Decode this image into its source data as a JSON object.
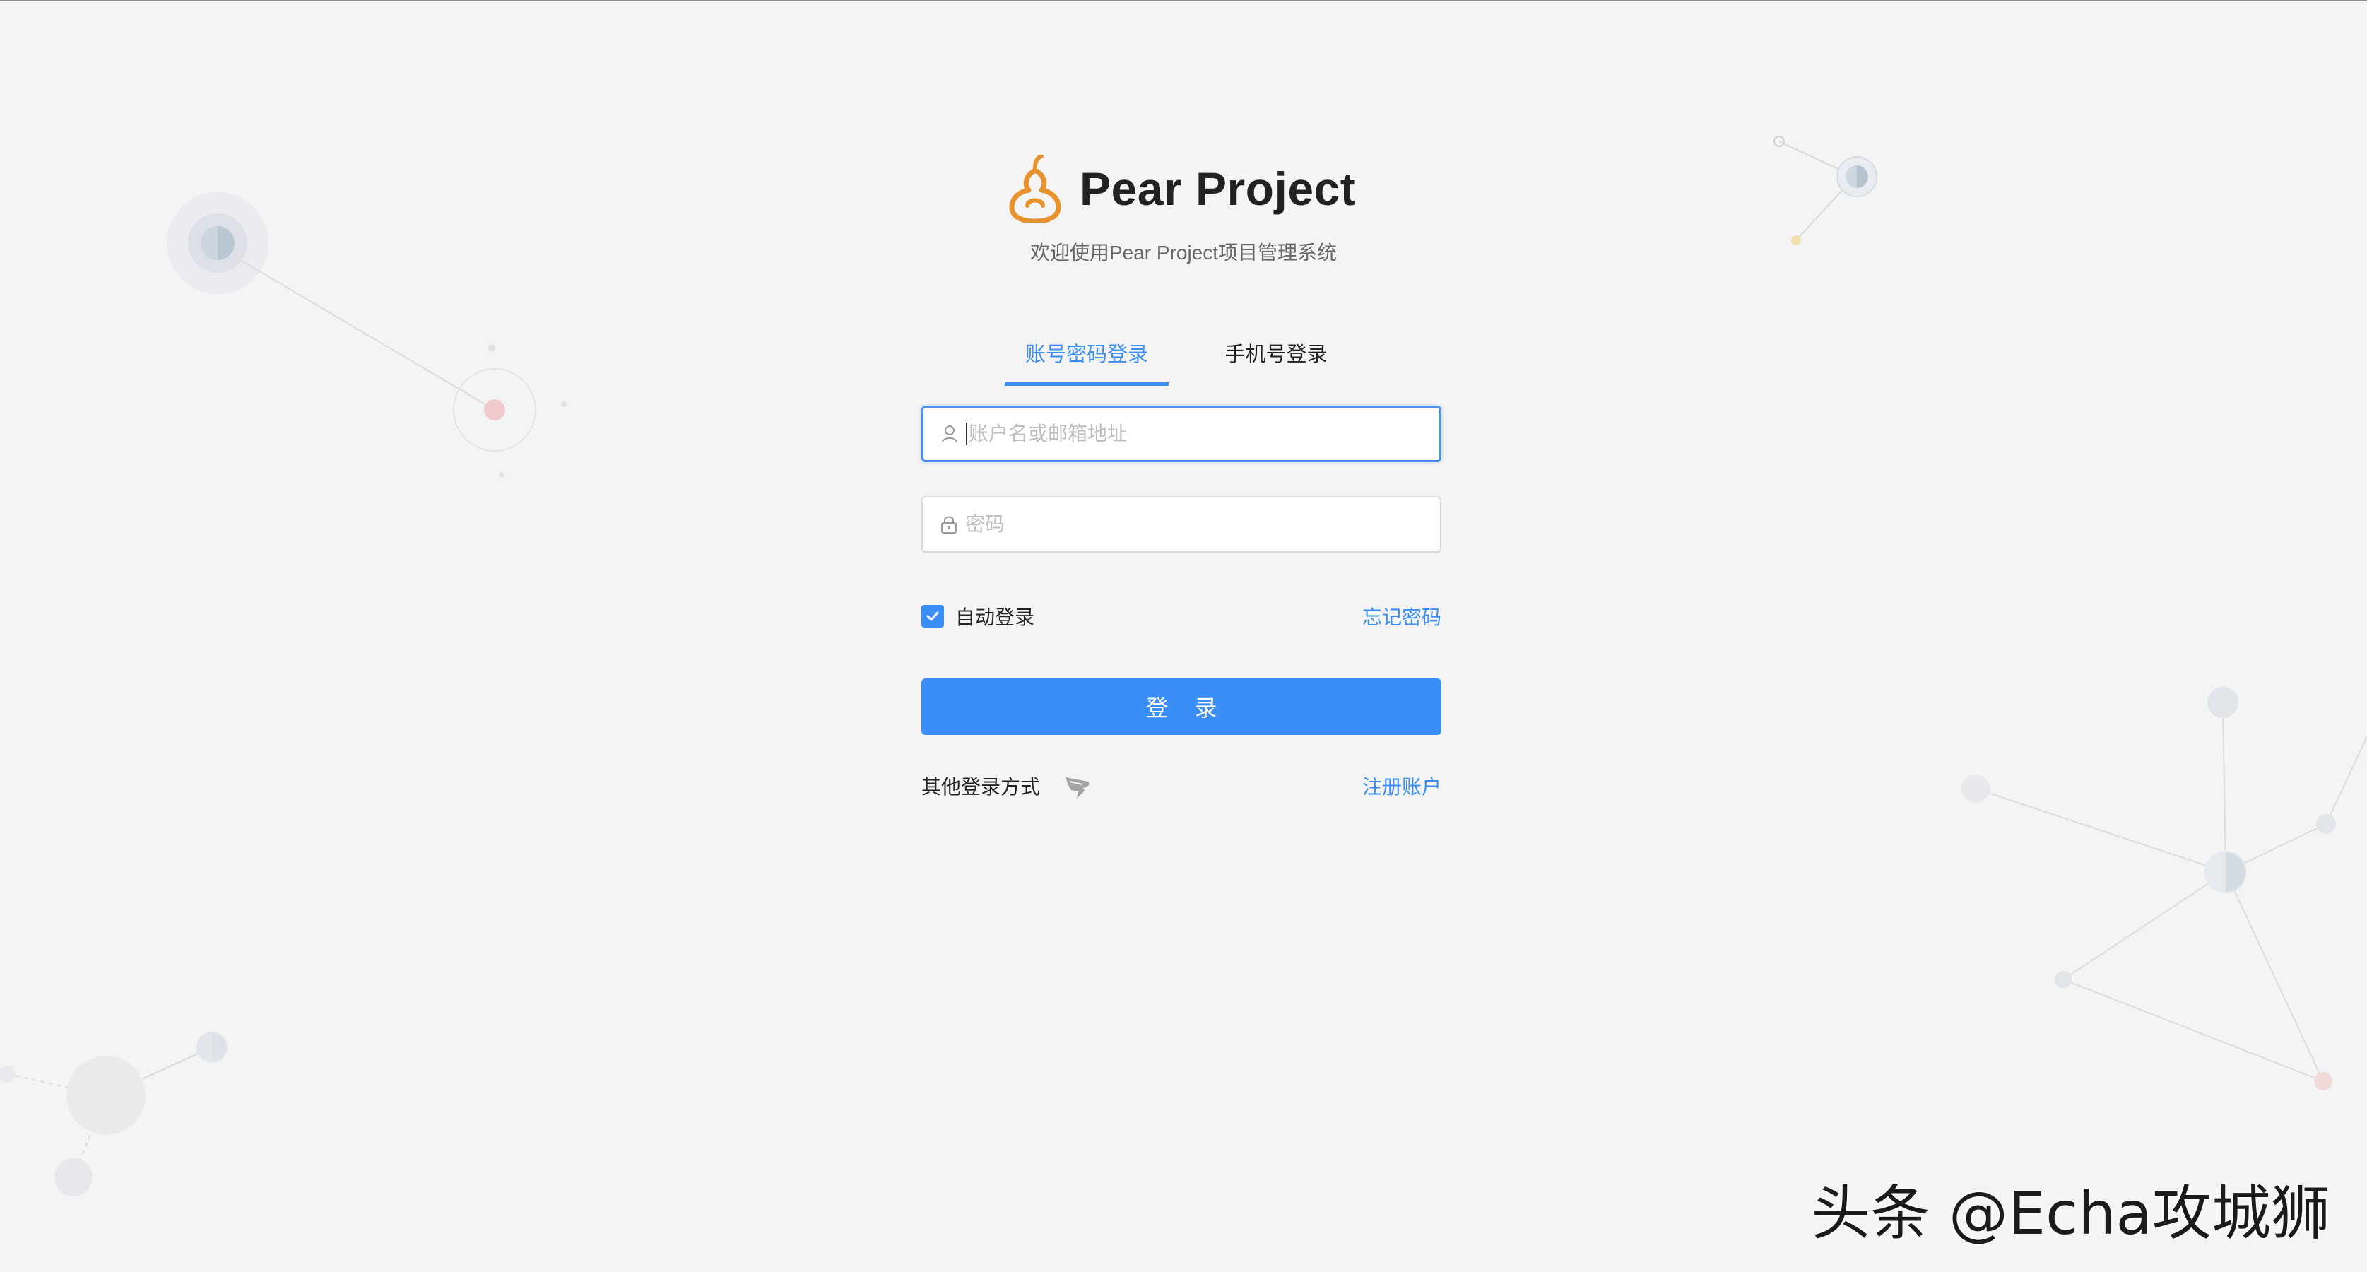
{
  "brand": {
    "title": "Pear Project",
    "subtitle": "欢迎使用Pear Project项目管理系统",
    "logo_icon": "pear-logo-icon"
  },
  "tabs": [
    {
      "label": "账号密码登录",
      "active": true
    },
    {
      "label": "手机号登录",
      "active": false
    }
  ],
  "form": {
    "username": {
      "value": "",
      "placeholder": "账户名或邮箱地址",
      "icon": "user-icon"
    },
    "password": {
      "value": "",
      "placeholder": "密码",
      "icon": "lock-icon"
    },
    "remember": {
      "label": "自动登录",
      "checked": true
    },
    "forgot_label": "忘记密码",
    "submit_label": "登 录"
  },
  "footer": {
    "other_label": "其他登录方式",
    "other_icon": "dingtalk-icon",
    "register_label": "注册账户"
  },
  "watermark": "头条 @Echa攻城狮",
  "colors": {
    "accent": "#3a8ef6",
    "background": "#f4f4f4",
    "logo": "#e8922e"
  }
}
